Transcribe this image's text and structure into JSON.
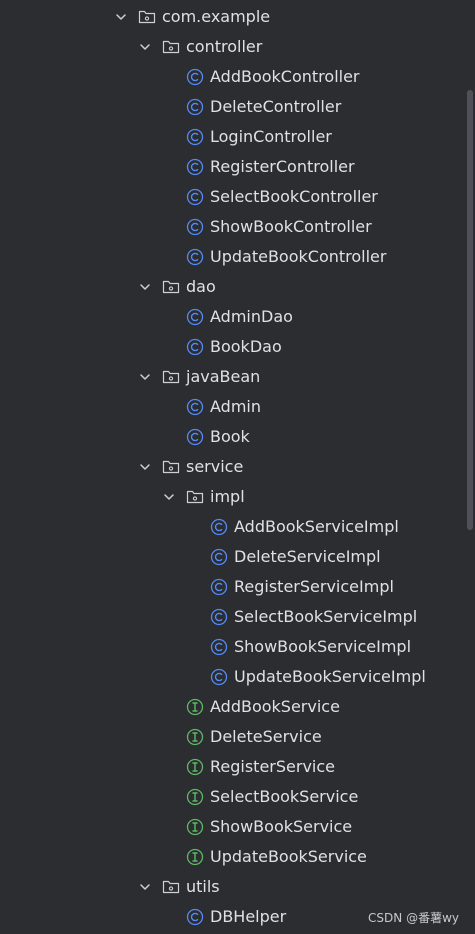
{
  "tree": [
    {
      "label": "com.example",
      "type": "package",
      "depth": 0,
      "expanded": true
    },
    {
      "label": "controller",
      "type": "package",
      "depth": 1,
      "expanded": true
    },
    {
      "label": "AddBookController",
      "type": "class",
      "depth": 2
    },
    {
      "label": "DeleteController",
      "type": "class",
      "depth": 2
    },
    {
      "label": "LoginController",
      "type": "class",
      "depth": 2
    },
    {
      "label": "RegisterController",
      "type": "class",
      "depth": 2
    },
    {
      "label": "SelectBookController",
      "type": "class",
      "depth": 2
    },
    {
      "label": "ShowBookController",
      "type": "class",
      "depth": 2
    },
    {
      "label": "UpdateBookController",
      "type": "class",
      "depth": 2
    },
    {
      "label": "dao",
      "type": "package",
      "depth": 1,
      "expanded": true
    },
    {
      "label": "AdminDao",
      "type": "class",
      "depth": 2
    },
    {
      "label": "BookDao",
      "type": "class",
      "depth": 2
    },
    {
      "label": "javaBean",
      "type": "package",
      "depth": 1,
      "expanded": true
    },
    {
      "label": "Admin",
      "type": "class",
      "depth": 2
    },
    {
      "label": "Book",
      "type": "class",
      "depth": 2
    },
    {
      "label": "service",
      "type": "package",
      "depth": 1,
      "expanded": true
    },
    {
      "label": "impl",
      "type": "package",
      "depth": 2,
      "expanded": true
    },
    {
      "label": "AddBookServiceImpl",
      "type": "class",
      "depth": 3
    },
    {
      "label": "DeleteServiceImpl",
      "type": "class",
      "depth": 3
    },
    {
      "label": "RegisterServiceImpl",
      "type": "class",
      "depth": 3
    },
    {
      "label": "SelectBookServiceImpl",
      "type": "class",
      "depth": 3
    },
    {
      "label": "ShowBookServiceImpl",
      "type": "class",
      "depth": 3
    },
    {
      "label": "UpdateBookServiceImpl",
      "type": "class",
      "depth": 3
    },
    {
      "label": "AddBookService",
      "type": "interface",
      "depth": 2
    },
    {
      "label": "DeleteService",
      "type": "interface",
      "depth": 2
    },
    {
      "label": "RegisterService",
      "type": "interface",
      "depth": 2
    },
    {
      "label": "SelectBookService",
      "type": "interface",
      "depth": 2
    },
    {
      "label": "ShowBookService",
      "type": "interface",
      "depth": 2
    },
    {
      "label": "UpdateBookService",
      "type": "interface",
      "depth": 2
    },
    {
      "label": "utils",
      "type": "package",
      "depth": 1,
      "expanded": true
    },
    {
      "label": "DBHelper",
      "type": "class",
      "depth": 2
    }
  ],
  "watermark": "CSDN @番薯wy",
  "colors": {
    "background": "#2b2d30",
    "text": "#dfe1e5",
    "class_icon": "#548af7",
    "interface_icon": "#5fb865",
    "folder_icon": "#ced0d6",
    "chevron": "#ced0d6"
  },
  "icons": {
    "package": "package-folder-icon",
    "class": "java-class-icon",
    "interface": "java-interface-icon",
    "chevron": "chevron-down-icon"
  }
}
